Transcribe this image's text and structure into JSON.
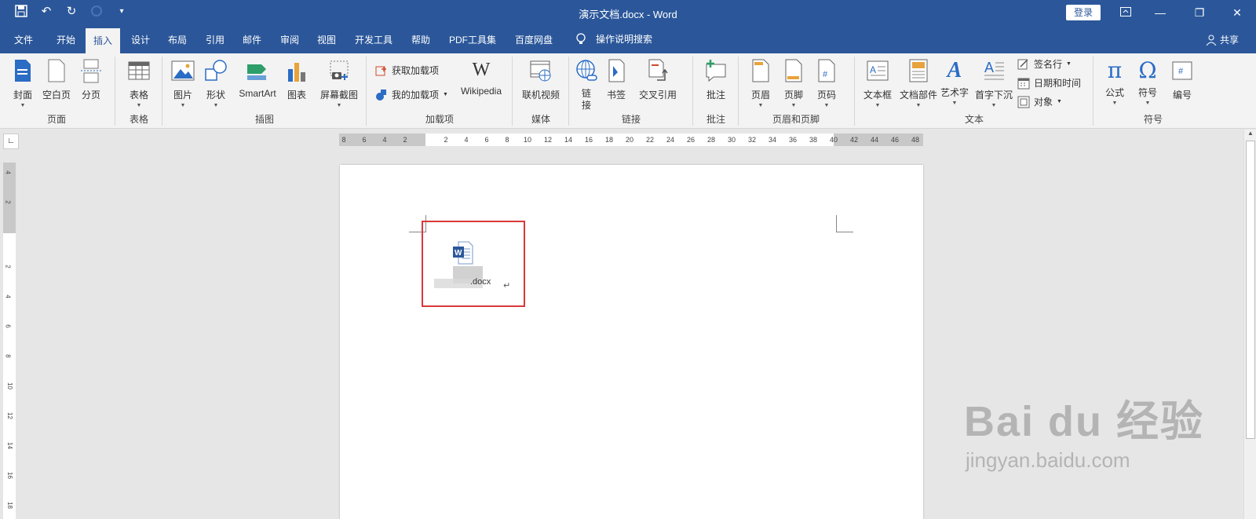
{
  "title": "演示文档.docx  -  Word",
  "login_label": "登录",
  "menu_tabs": [
    "文件",
    "开始",
    "插入",
    "设计",
    "布局",
    "引用",
    "邮件",
    "审阅",
    "视图",
    "开发工具",
    "帮助",
    "PDF工具集",
    "百度网盘"
  ],
  "active_tab": "插入",
  "tell_me": "操作说明搜索",
  "share_label": "共享",
  "ribbon": {
    "pages": {
      "label": "页面",
      "cover": "封面",
      "blank": "空白页",
      "break": "分页"
    },
    "table": {
      "label": "表格",
      "table": "表格"
    },
    "illustrations": {
      "label": "插图",
      "picture": "图片",
      "shape": "形状",
      "smartart": "SmartArt",
      "chart": "图表",
      "screenshot": "屏幕截图"
    },
    "addins": {
      "label": "加载项",
      "get": "获取加载项",
      "mine": "我的加载项",
      "wikipedia": "Wikipedia"
    },
    "media": {
      "label": "媒体",
      "video": "联机视频"
    },
    "links": {
      "label": "链接",
      "link": "链接",
      "bookmark": "书签",
      "crossref": "交叉引用"
    },
    "comments": {
      "label": "批注",
      "comment": "批注"
    },
    "headerfooter": {
      "label": "页眉和页脚",
      "header": "页眉",
      "footer": "页脚",
      "pagenum": "页码"
    },
    "text": {
      "label": "文本",
      "textbox": "文本框",
      "quickparts": "文档部件",
      "wordart": "艺术字",
      "dropcap": "首字下沉",
      "signature": "签名行",
      "datetime": "日期和时间",
      "object": "对象"
    },
    "symbols": {
      "label": "符号",
      "equation": "公式",
      "symbol": "符号",
      "number": "编号"
    }
  },
  "ruler_h": [
    "8",
    "6",
    "4",
    "2",
    "",
    "2",
    "4",
    "6",
    "8",
    "10",
    "12",
    "14",
    "16",
    "18",
    "20",
    "22",
    "24",
    "26",
    "28",
    "30",
    "32",
    "34",
    "36",
    "38",
    "40",
    "42",
    "44",
    "46",
    "48"
  ],
  "ruler_v": [
    "4",
    "2",
    "2",
    "4",
    "6",
    "8",
    "10",
    "12",
    "14",
    "16",
    "18"
  ],
  "embedded_file": ".docx",
  "watermark": {
    "logo": "Bai du 经验",
    "url": "jingyan.baidu.com"
  },
  "colors": {
    "brand": "#2b579a",
    "highlight": "#d9383a"
  }
}
